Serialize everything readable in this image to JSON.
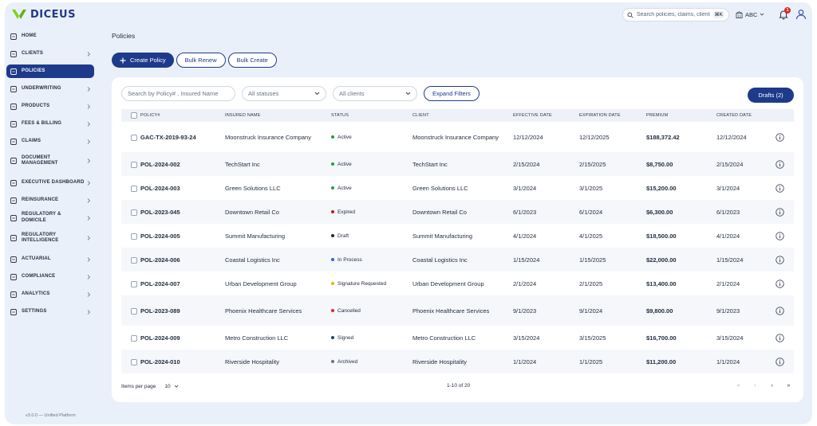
{
  "app": {
    "brand": "DICEUS",
    "version": "v3.0.0 — Unified Platform",
    "colors": {
      "primary": "#1e3a8a",
      "background": "#eaf0f9",
      "logo_green": "#7ed321"
    }
  },
  "topbar": {
    "search_placeholder": "Search policies, claims, clients",
    "search_shortcut": "⌘K",
    "org": "ABC",
    "notification_count": "1"
  },
  "sidebar": {
    "items": [
      {
        "label": "HOME",
        "icon": "home-icon",
        "chevron": false
      },
      {
        "label": "CLIENTS",
        "icon": "users-icon",
        "chevron": true
      },
      {
        "label": "POLICIES",
        "icon": "shield-icon",
        "chevron": false,
        "active": true
      },
      {
        "label": "UNDERWRITING",
        "icon": "pen-icon",
        "chevron": true
      },
      {
        "label": "PRODUCTS",
        "icon": "grid-icon",
        "chevron": true
      },
      {
        "label": "FEES & BILLING",
        "icon": "card-icon",
        "chevron": true
      },
      {
        "label": "CLAIMS",
        "icon": "folder-icon",
        "chevron": true
      },
      {
        "label": "DOCUMENT MANAGEMENT",
        "icon": "document-icon",
        "chevron": true
      },
      {
        "label": "EXECUTIVE DASHBOARD",
        "icon": "chart-icon",
        "chevron": true
      },
      {
        "label": "REINSURANCE",
        "icon": "shield-icon",
        "chevron": true
      },
      {
        "label": "REGULATORY & DOMICILE",
        "icon": "shield-check-icon",
        "chevron": true
      },
      {
        "label": "REGULATORY INTELLIGENCE",
        "icon": "shield-check-icon",
        "chevron": true
      },
      {
        "label": "ACTUARIAL",
        "icon": "trend-icon",
        "chevron": true
      },
      {
        "label": "COMPLIANCE",
        "icon": "checklist-icon",
        "chevron": true
      },
      {
        "label": "ANALYTICS",
        "icon": "pulse-icon",
        "chevron": true
      },
      {
        "label": "SETTINGS",
        "icon": "gear-icon",
        "chevron": true
      }
    ]
  },
  "page": {
    "title": "Policies",
    "create_label": "Create Policy",
    "bulk_renew_label": "Bulk Renew",
    "bulk_create_label": "Bulk Create"
  },
  "filters": {
    "search_placeholder": "Search by Policy# , Insured Name",
    "status_value": "All statuses",
    "client_value": "All clients",
    "expand_label": "Expand Filters",
    "drafts_label": "Drafts (2)"
  },
  "table": {
    "columns": [
      "POLICY#",
      "INSURED NAME",
      "STATUS",
      "CLIENT",
      "EFFECTIVE DATE",
      "EXPIRATION DATE",
      "PREMIUM",
      "CREATED DATE"
    ],
    "status_colors": {
      "Active": "#16a34a",
      "Expired": "#b91c1c",
      "Draft": "#1f2937",
      "In Process": "#2563eb",
      "Signature Requested": "#eab308",
      "Cancelled": "#dc2626",
      "Signed": "#1e3a8a",
      "Archived": "#6b7280"
    },
    "rows": [
      {
        "policy": "GAC-TX-2019-93-24",
        "insured": "Moonstruck Insurance Company",
        "status": "Active",
        "client": "Moonstruck Insurance Company",
        "effective": "12/12/2024",
        "expiration": "12/12/2025",
        "premium": "$188,372.42",
        "created": "12/12/2024"
      },
      {
        "policy": "POL-2024-002",
        "insured": "TechStart Inc",
        "status": "Active",
        "client": "TechStart Inc",
        "effective": "2/15/2024",
        "expiration": "2/15/2025",
        "premium": "$8,750.00",
        "created": "2/15/2024"
      },
      {
        "policy": "POL-2024-003",
        "insured": "Green Solutions LLC",
        "status": "Active",
        "client": "Green Solutions LLC",
        "effective": "3/1/2024",
        "expiration": "3/1/2025",
        "premium": "$15,200.00",
        "created": "3/1/2024"
      },
      {
        "policy": "POL-2023-045",
        "insured": "Downtown Retail Co",
        "status": "Expired",
        "client": "Downtown Retail Co",
        "effective": "6/1/2023",
        "expiration": "6/1/2024",
        "premium": "$6,300.00",
        "created": "6/1/2023"
      },
      {
        "policy": "POL-2024-005",
        "insured": "Summit Manufacturing",
        "status": "Draft",
        "client": "Summit Manufacturing",
        "effective": "4/1/2024",
        "expiration": "4/1/2025",
        "premium": "$18,500.00",
        "created": "4/1/2024"
      },
      {
        "policy": "POL-2024-006",
        "insured": "Coastal Logistics Inc",
        "status": "In Process",
        "client": "Coastal Logistics Inc",
        "effective": "1/15/2024",
        "expiration": "1/15/2025",
        "premium": "$22,000.00",
        "created": "1/15/2024"
      },
      {
        "policy": "POL-2024-007",
        "insured": "Urban Development Group",
        "status": "Signature Requested",
        "client": "Urban Development Group",
        "effective": "2/1/2024",
        "expiration": "2/1/2025",
        "premium": "$13,400.00",
        "created": "2/1/2024"
      },
      {
        "policy": "POL-2023-089",
        "insured": "Phoenix Healthcare Services",
        "status": "Cancelled",
        "client": "Phoenix Healthcare Services",
        "effective": "9/1/2023",
        "expiration": "9/1/2024",
        "premium": "$9,800.00",
        "created": "9/1/2023"
      },
      {
        "policy": "POL-2024-009",
        "insured": "Metro Construction LLC",
        "status": "Signed",
        "client": "Metro Construction LLC",
        "effective": "3/15/2024",
        "expiration": "3/15/2025",
        "premium": "$16,700.00",
        "created": "3/15/2024"
      },
      {
        "policy": "POL-2024-010",
        "insured": "Riverside Hospitality",
        "status": "Archived",
        "client": "Riverside Hospitality",
        "effective": "1/1/2024",
        "expiration": "1/1/2025",
        "premium": "$11,200.00",
        "created": "1/1/2024"
      }
    ]
  },
  "pagination": {
    "items_per_page_label": "Items per page",
    "items_per_page_value": "10",
    "range": "1-10 of 20",
    "buttons": [
      "«",
      "‹",
      "›",
      "»"
    ]
  }
}
